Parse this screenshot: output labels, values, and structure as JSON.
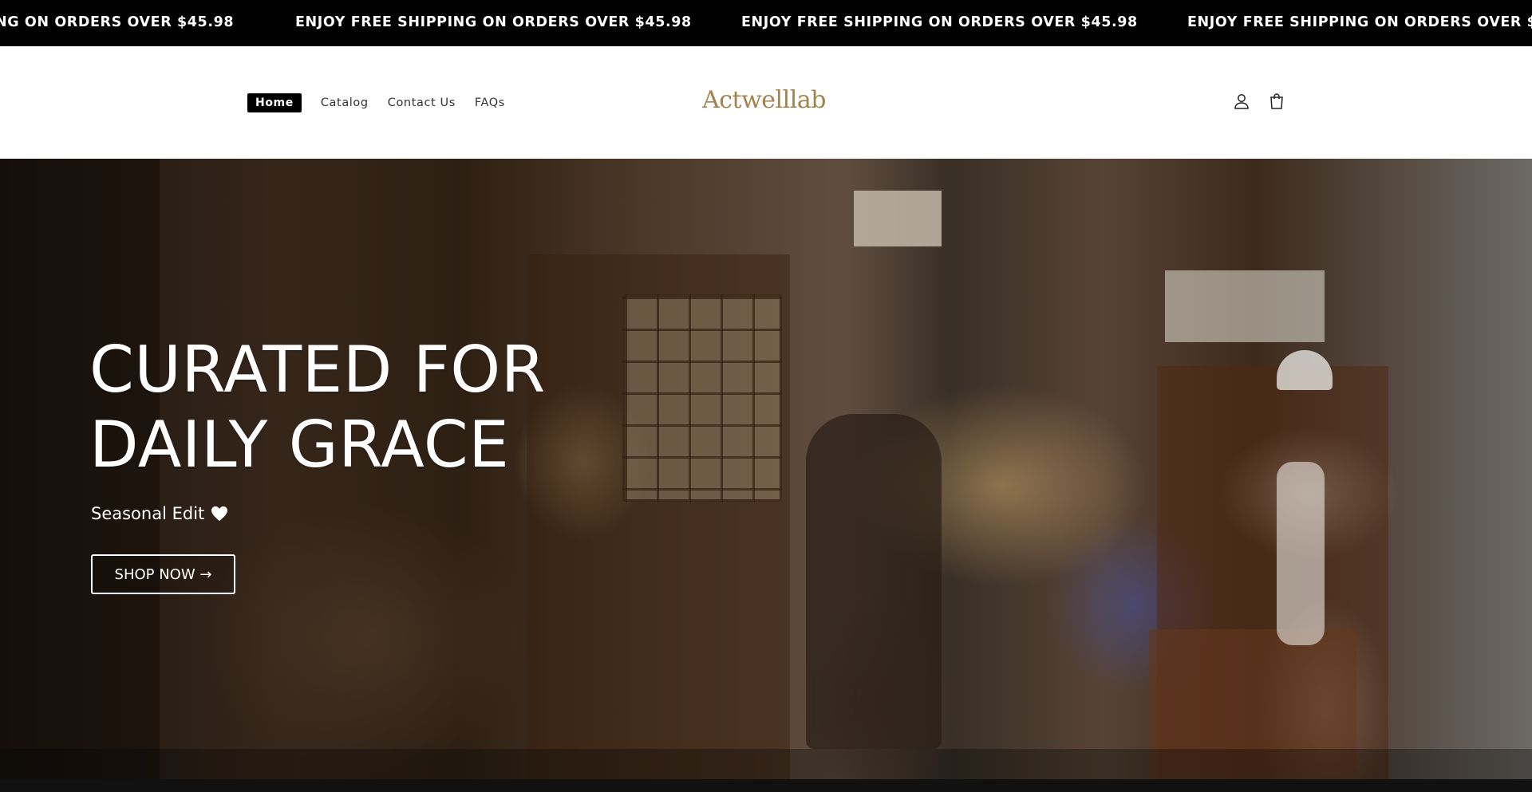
{
  "announcement": {
    "items": [
      "NG ON ORDERS OVER $45.98",
      "ENJOY FREE SHIPPING ON ORDERS OVER $45.98",
      "ENJOY FREE SHIPPING ON ORDERS OVER $45.98",
      "ENJOY FREE SHIPPING ON ORDERS OVER $45."
    ],
    "background": "#000000",
    "text_color": "#ffffff"
  },
  "header": {
    "nav": [
      {
        "label": "Home",
        "active": true
      },
      {
        "label": "Catalog",
        "active": false
      },
      {
        "label": "Contact Us",
        "active": false
      },
      {
        "label": "FAQs",
        "active": false
      }
    ],
    "logo": "Actwelllab",
    "logo_color": "#a3824c",
    "icons": [
      "account-icon",
      "cart-icon"
    ]
  },
  "hero": {
    "title_line1": "CURATED FOR",
    "title_line2": "DAILY GRACE",
    "subtitle": "Seasonal Edit",
    "subtitle_icon": "heart-icon",
    "button_label": "SHOP NOW →"
  }
}
